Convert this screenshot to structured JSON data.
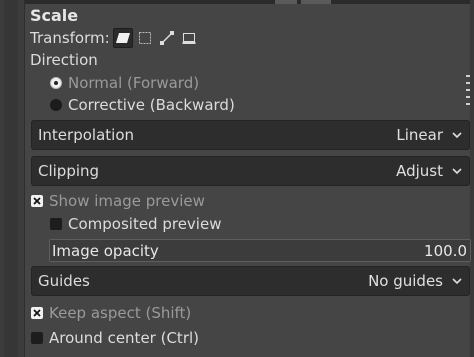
{
  "title": "Scale",
  "transform": {
    "label": "Transform:",
    "options": [
      {
        "icon": "layer-transform-icon",
        "active": true
      },
      {
        "icon": "selection-transform-icon",
        "active": false
      },
      {
        "icon": "path-transform-icon",
        "active": false
      },
      {
        "icon": "image-transform-icon",
        "active": false
      }
    ]
  },
  "direction": {
    "label": "Direction",
    "options": [
      {
        "label": "Normal (Forward)",
        "checked": true
      },
      {
        "label": "Corrective (Backward)",
        "checked": false
      }
    ]
  },
  "interpolation": {
    "label": "Interpolation",
    "value": "Linear"
  },
  "clipping": {
    "label": "Clipping",
    "value": "Adjust"
  },
  "show_preview": {
    "label": "Show image preview",
    "checked": true
  },
  "composited_preview": {
    "label": "Composited preview",
    "checked": false
  },
  "image_opacity": {
    "label": "Image opacity",
    "value": "100.0",
    "fraction": 1.0
  },
  "guides": {
    "label": "Guides",
    "value": "No guides"
  },
  "keep_aspect": {
    "label": "Keep aspect (Shift)",
    "checked": true
  },
  "around_center": {
    "label": "Around center (Ctrl)",
    "checked": false
  }
}
